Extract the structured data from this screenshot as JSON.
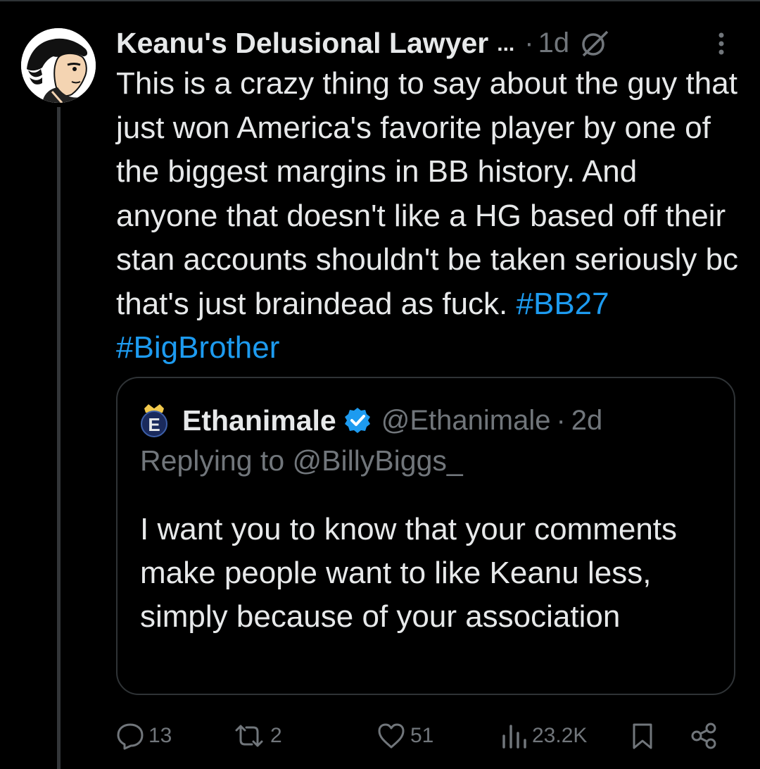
{
  "post": {
    "author_name": "Keanu's Delusional Lawyer",
    "name_ellipsis": "...",
    "separator": "·",
    "time": "1d",
    "text": "This is a crazy thing to say about the guy that just won America's favorite player by one of the biggest margins in BB history. And anyone that doesn't like a HG based off their stan accounts shouldn't be taken seriously bc that's just braindead as fuck.",
    "hashtags": [
      "#BB27",
      "#BigBrother"
    ]
  },
  "quote": {
    "name": "Ethanimale",
    "avatar_letter": "E",
    "handle": "@Ethanimale",
    "separator": "·",
    "time": "2d",
    "replying_to": "Replying to @BillyBiggs_",
    "text": "I want you to know that your comments make people want to like Keanu less, simply because of your association"
  },
  "actions": {
    "replies": "13",
    "reposts": "2",
    "likes": "51",
    "views": "23.2K"
  },
  "colors": {
    "background": "#000000",
    "text": "#e7e9ea",
    "muted": "#71767b",
    "accent": "#1d9bf0",
    "border": "#2f3336"
  },
  "icons": [
    "avatar",
    "edit-history-icon",
    "more-icon",
    "verified-badge-icon",
    "reply-icon",
    "repost-icon",
    "like-icon",
    "views-icon",
    "bookmark-icon",
    "share-icon"
  ]
}
